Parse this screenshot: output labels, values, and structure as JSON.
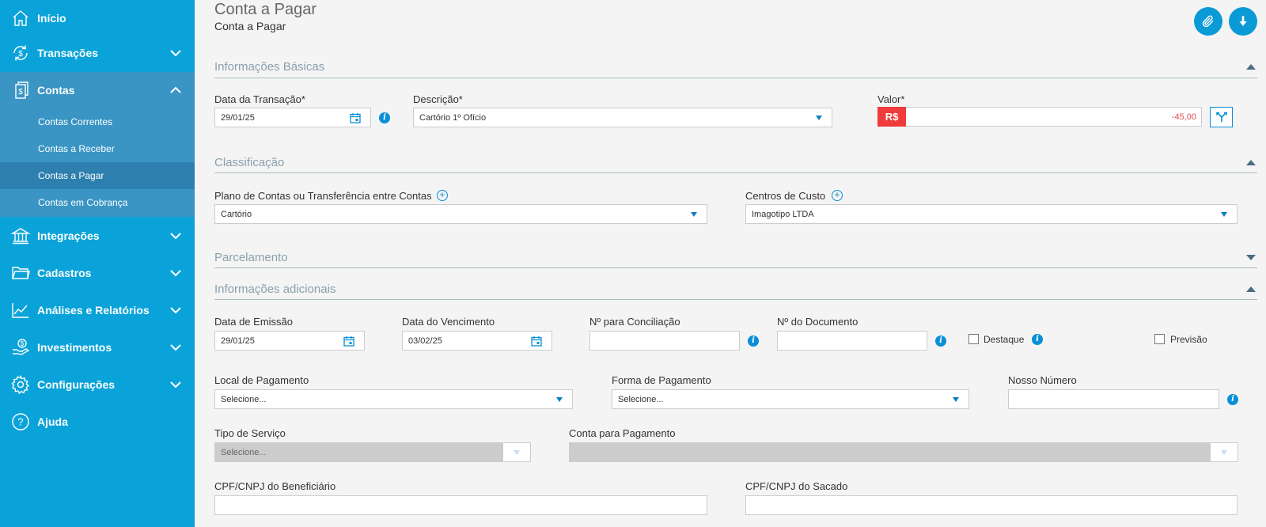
{
  "sidebar": {
    "items": [
      {
        "label": "Início"
      },
      {
        "label": "Transações"
      },
      {
        "label": "Contas"
      },
      {
        "label": "Integrações"
      },
      {
        "label": "Cadastros"
      },
      {
        "label": "Análises e Relatórios"
      },
      {
        "label": "Investimentos"
      },
      {
        "label": "Configurações"
      },
      {
        "label": "Ajuda"
      }
    ],
    "contas_submenu": [
      {
        "label": "Contas Correntes"
      },
      {
        "label": "Contas a Receber"
      },
      {
        "label": "Contas a Pagar"
      },
      {
        "label": "Contas em Cobrança"
      }
    ]
  },
  "header": {
    "title": "Conta a Pagar",
    "subtitle": "Conta a Pagar",
    "attach_icon": "paperclip-icon",
    "download_icon": "download-icon"
  },
  "sections": {
    "basic": "Informações Básicas",
    "classification": "Classificação",
    "installments": "Parcelamento",
    "additional": "Informações adicionais"
  },
  "basic": {
    "date_label": "Data da Transação*",
    "date_value": "29/01/25",
    "description_label": "Descrição*",
    "description_value": "Cartório 1º Ofício",
    "value_label": "Valor*",
    "currency": "R$",
    "value": "-45,00"
  },
  "classification": {
    "plan_label": "Plano de Contas ou Transferência entre Contas",
    "plan_value": "Cartório",
    "cost_center_label": "Centros de Custo",
    "cost_center_value": "Imagotipo LTDA"
  },
  "additional": {
    "emission_label": "Data de Emissão",
    "emission_value": "29/01/25",
    "due_label": "Data do Vencimento",
    "due_value": "03/02/25",
    "reconciliation_label": "Nº para Conciliação",
    "reconciliation_value": "",
    "document_label": "Nº do Documento",
    "document_value": "",
    "highlight_label": "Destaque",
    "forecast_label": "Previsão",
    "payment_place_label": "Local de Pagamento",
    "payment_place_value": "Selecione...",
    "payment_method_label": "Forma de Pagamento",
    "payment_method_value": "Selecione...",
    "our_number_label": "Nosso Número",
    "our_number_value": "",
    "service_type_label": "Tipo de Serviço",
    "service_type_value": "Selecione...",
    "payment_account_label": "Conta para Pagamento",
    "payment_account_value": "",
    "beneficiary_doc_label": "CPF/CNPJ do Beneficiário",
    "beneficiary_doc_value": "",
    "drawee_doc_label": "CPF/CNPJ do Sacado",
    "drawee_doc_value": ""
  },
  "colors": {
    "sidebar": "#0aa3d9",
    "sidebar_expanded": "#3a95c4",
    "accent": "#0a9ad6",
    "negative": "#ee3b3b"
  }
}
